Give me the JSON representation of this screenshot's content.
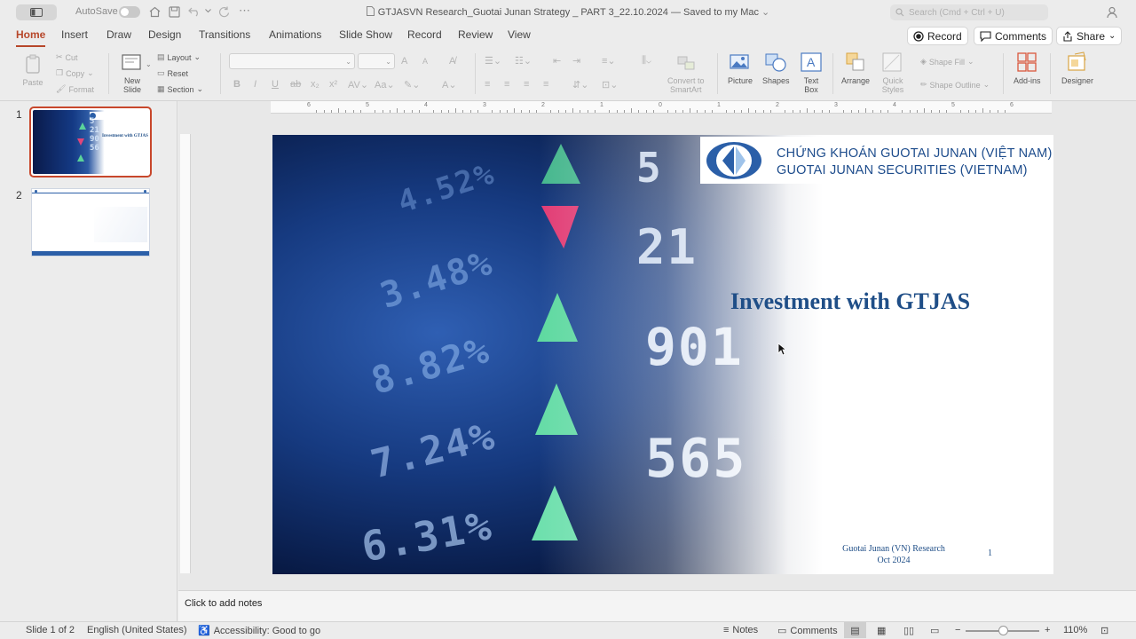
{
  "window": {
    "autosave_label": "AutoSave",
    "title": "GTJASVN Research_Guotai Junan Strategy _ PART 3_22.10.2024 — Saved to my Mac",
    "search_placeholder": "Search (Cmd + Ctrl + U)"
  },
  "tabs": [
    "Home",
    "Insert",
    "Draw",
    "Design",
    "Transitions",
    "Animations",
    "Slide Show",
    "Record",
    "Review",
    "View"
  ],
  "active_tab": "Home",
  "top_buttons": {
    "record": "Record",
    "comments": "Comments",
    "share": "Share"
  },
  "ribbon": {
    "paste": "Paste",
    "cut": "Cut",
    "copy": "Copy",
    "format": "Format",
    "new_slide_1": "New",
    "new_slide_2": "Slide",
    "layout": "Layout",
    "reset": "Reset",
    "section": "Section",
    "convert_1": "Convert to",
    "convert_2": "SmartArt",
    "picture": "Picture",
    "shapes": "Shapes",
    "textbox_1": "Text",
    "textbox_2": "Box",
    "arrange": "Arrange",
    "quick_styles_1": "Quick",
    "quick_styles_2": "Styles",
    "shape_fill": "Shape Fill",
    "shape_outline": "Shape Outline",
    "addins": "Add-ins",
    "designer": "Designer"
  },
  "thumbnails": {
    "slide1_num": "1",
    "slide2_num": "2",
    "thumb1_title": "Investment with GTJAS"
  },
  "slide": {
    "logo_line1": "CHỨNG KHOÁN GUOTAI JUNAN (VIỆT NAM)",
    "logo_line2": "GUOTAI JUNAN SECURITIES (VIETNAM)",
    "title": "Investment with GTJAS",
    "footer_line1": "Guotai Junan (VN) Research",
    "footer_line2": "Oct 2024",
    "page_number": "1"
  },
  "notes_placeholder": "Click to add notes",
  "status": {
    "slide_count": "Slide 1 of 2",
    "language": "English (United States)",
    "accessibility": "Accessibility: Good to go",
    "notes": "Notes",
    "comments": "Comments",
    "zoom": "110%"
  },
  "ruler_h": [
    "6",
    "5",
    "4",
    "3",
    "2",
    "1",
    "0",
    "1",
    "2",
    "3",
    "4",
    "5",
    "6"
  ],
  "colors": {
    "accent": "#b7472a",
    "brand": "#1f4e87"
  }
}
